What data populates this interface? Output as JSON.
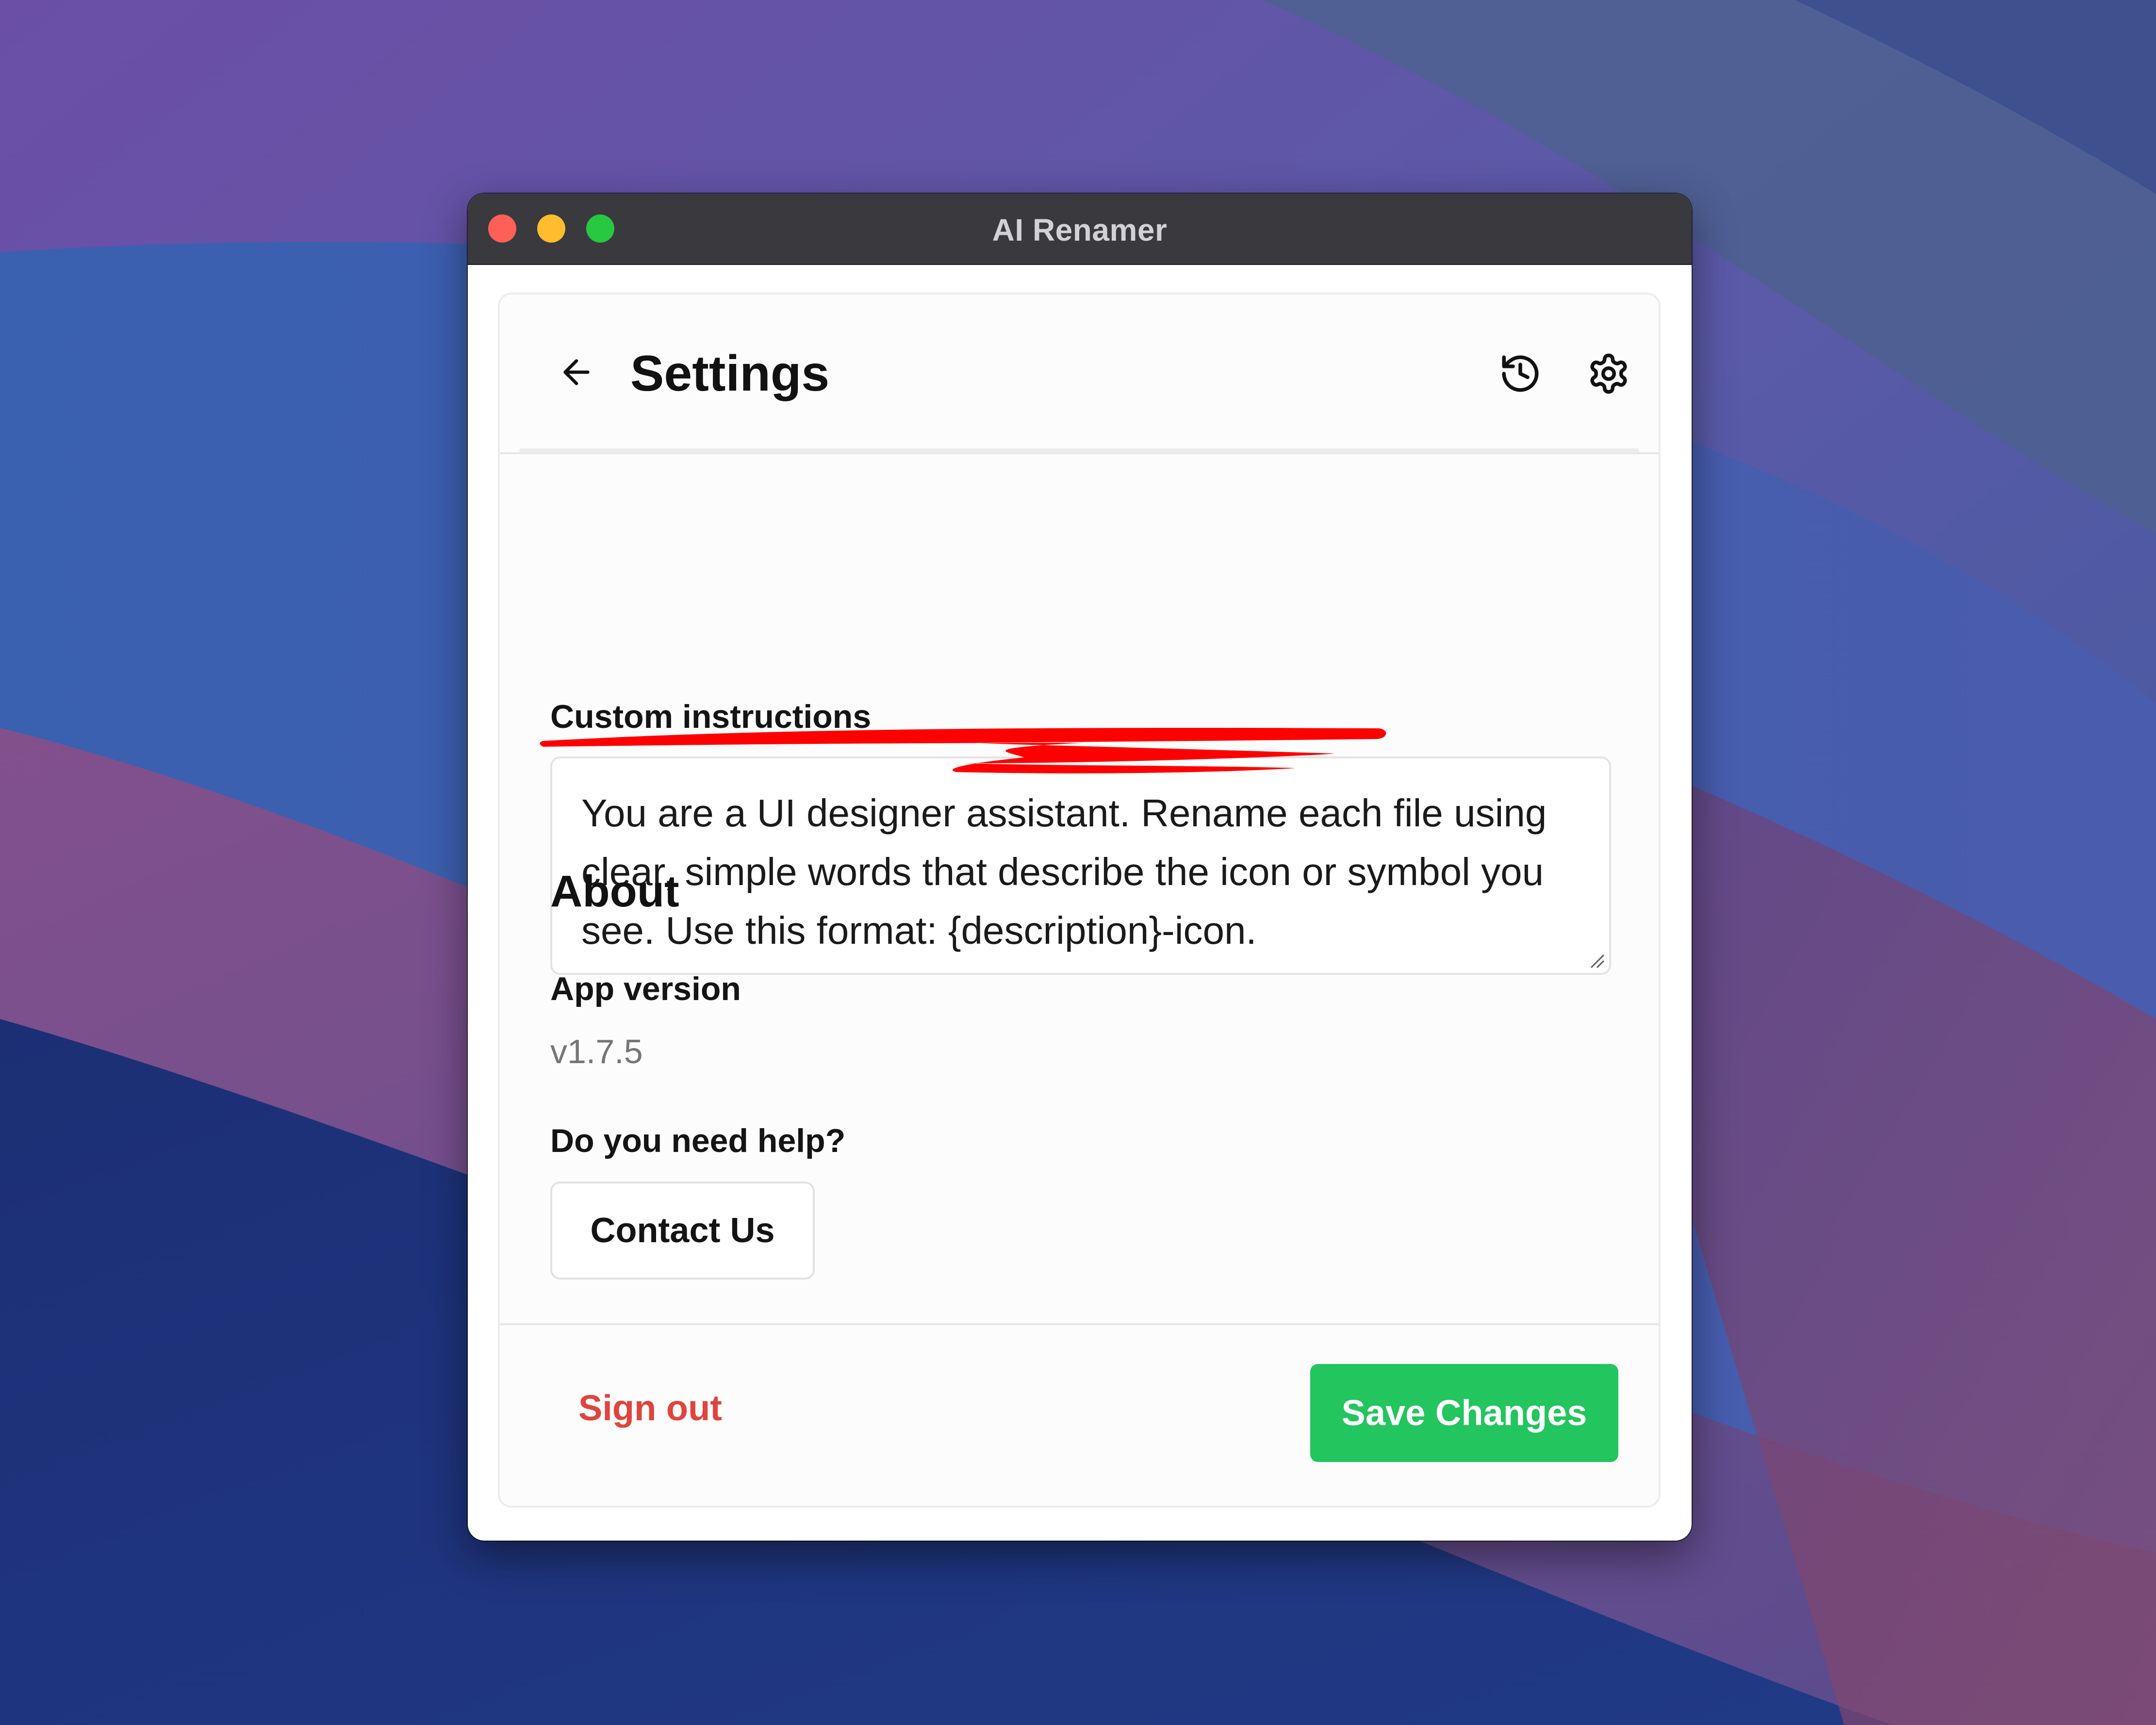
{
  "window": {
    "title": "AI Renamer"
  },
  "header": {
    "title": "Settings",
    "icons": [
      "arrow-left-icon",
      "history-icon",
      "gear-icon"
    ]
  },
  "custom_instructions": {
    "label": "Custom instructions",
    "value": "You are a UI designer assistant. Rename each file using clear, simple words that describe the icon or symbol you see. Use this format: {description}-icon."
  },
  "about": {
    "heading": "About",
    "app_version_label": "App version",
    "app_version_value": "v1.7.5",
    "help_label": "Do you need help?",
    "contact_button": "Contact Us"
  },
  "footer": {
    "sign_out": "Sign out",
    "save_button": "Save Changes"
  },
  "colors": {
    "save_button": "#22c55e",
    "sign_out": "#e0443e",
    "scribble": "#ff0000",
    "titlebar": "#3a393e"
  }
}
